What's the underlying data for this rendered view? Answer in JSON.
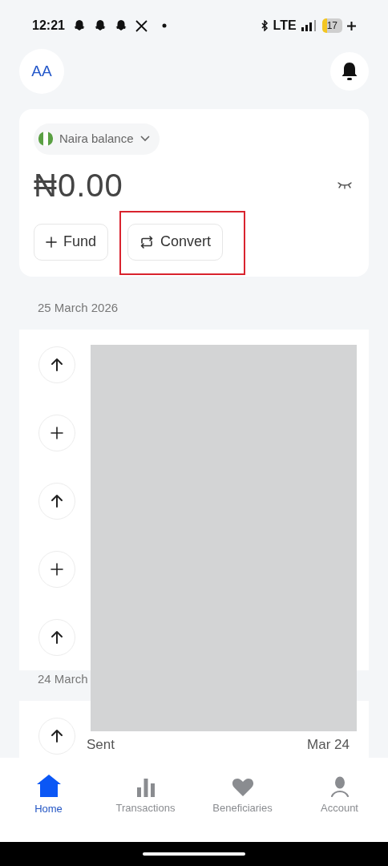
{
  "status_bar": {
    "time": "12:21",
    "network": "LTE",
    "battery": "17"
  },
  "header": {
    "avatar": "AA"
  },
  "balance_card": {
    "currency_label": "Naira balance",
    "amount": "₦0.00",
    "actions": [
      {
        "label": "Fund",
        "kind": "fund",
        "highlighted": false
      },
      {
        "label": "Convert",
        "kind": "convert",
        "highlighted": true
      }
    ]
  },
  "transaction_groups": [
    {
      "date": "25 March 2026",
      "items": [
        {
          "kind": "sent"
        },
        {
          "kind": "received"
        },
        {
          "kind": "sent"
        },
        {
          "kind": "received"
        },
        {
          "kind": "sent"
        }
      ]
    },
    {
      "date": "24 March",
      "items": [
        {
          "kind": "sent",
          "status": "Sent",
          "date": "Mar 24"
        }
      ]
    }
  ],
  "bottom_nav": [
    {
      "label": "Home",
      "kind": "home",
      "selected": true
    },
    {
      "label": "Transactions",
      "kind": "chart",
      "selected": false
    },
    {
      "label": "Beneficiaries",
      "kind": "heart",
      "selected": false
    },
    {
      "label": "Account",
      "kind": "person",
      "selected": false
    }
  ]
}
